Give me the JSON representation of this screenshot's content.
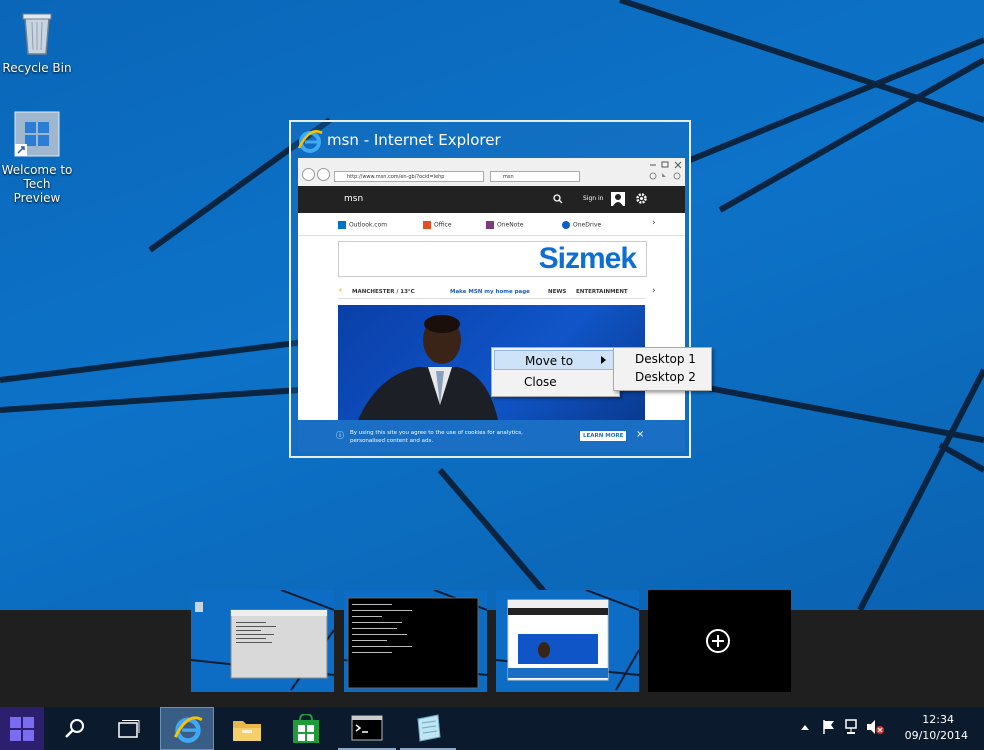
{
  "desktop": {
    "icons": [
      {
        "label": "Recycle Bin",
        "icon": "recycle-bin-icon"
      },
      {
        "label": "Welcome to Tech Preview",
        "icon": "windows-logo-icon"
      }
    ]
  },
  "window_preview": {
    "title": "msn - Internet Explorer",
    "thumbnail": {
      "address": "http://www.msn.com/en-gb/?ocid=iehp",
      "tab_label": "msn",
      "msn_logo": "msn",
      "sign_in": "Sign in",
      "services": [
        "Outlook.com",
        "Office",
        "OneNote",
        "OneDrive"
      ],
      "ad_text": "Sizmek",
      "weather": "MANCHESTER / 13°C",
      "make_home": "Make MSN my home page",
      "nav": [
        "NEWS",
        "ENTERTAINMENT"
      ],
      "cookie_text": "By using this site you agree to the use of cookies for analytics, personalised content and ads.",
      "learn_more": "LEARN MORE",
      "close_glyph": "×"
    }
  },
  "context_menu": {
    "items": [
      "Move to",
      "Close"
    ],
    "submenu": [
      "Desktop 1",
      "Desktop 2"
    ]
  },
  "virtual_desktops": {
    "add_label": "+"
  },
  "taskbar": {
    "clock_time": "12:34",
    "clock_date": "09/10/2014"
  }
}
